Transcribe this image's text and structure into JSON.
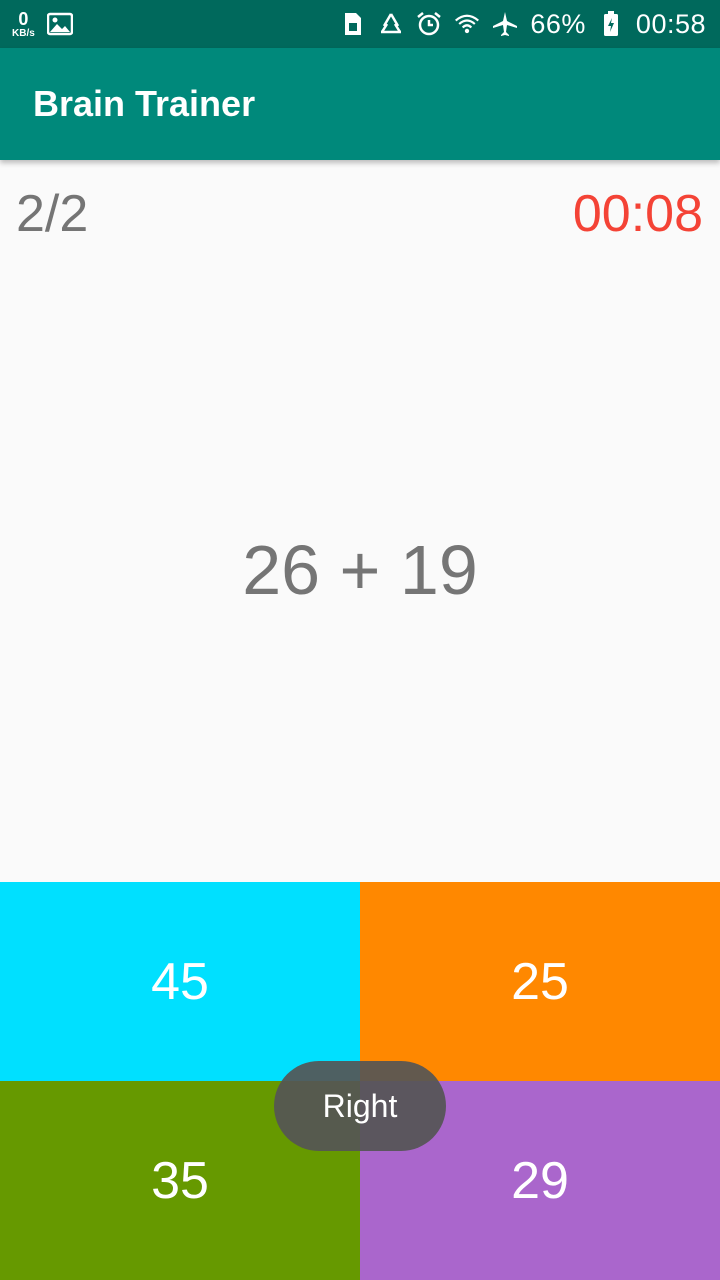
{
  "status_bar": {
    "net_speed_value": "0",
    "net_speed_unit": "KB/s",
    "battery": "66%",
    "time": "00:58",
    "icons": [
      "gallery-icon",
      "sim-icon",
      "recycle-icon",
      "alarm-icon",
      "wifi-icon",
      "airplane-icon",
      "battery-icon"
    ]
  },
  "app_bar": {
    "title": "Brain Trainer",
    "color": "#00897b"
  },
  "game": {
    "score": "2/2",
    "timer": "00:08",
    "question": "26 + 19",
    "answers": [
      {
        "label": "45",
        "color": "#00e0ff"
      },
      {
        "label": "25",
        "color": "#ff8800"
      },
      {
        "label": "35",
        "color": "#669900"
      },
      {
        "label": "29",
        "color": "#aa66cc"
      }
    ]
  },
  "toast": {
    "message": "Right"
  }
}
